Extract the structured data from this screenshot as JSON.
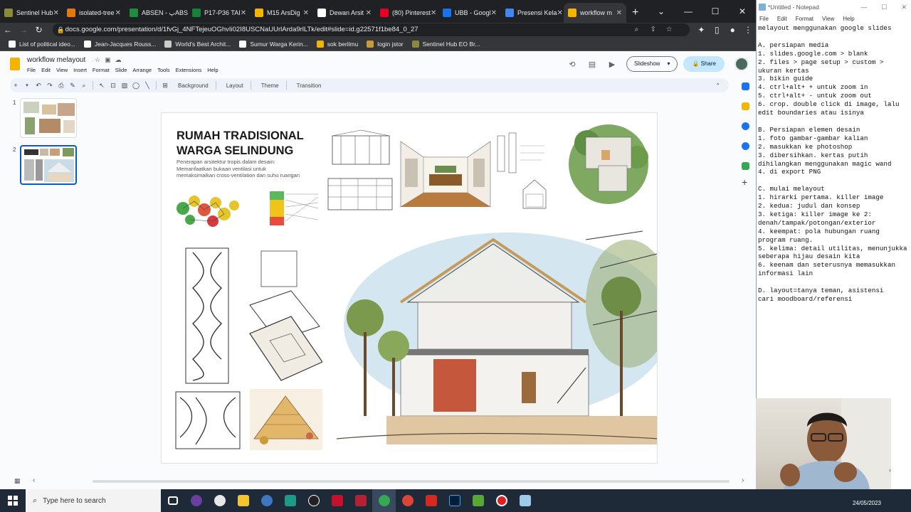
{
  "browser": {
    "tabs": [
      {
        "label": "Sentinel Hub",
        "color": "#8a8a3a"
      },
      {
        "label": "isolated-tree",
        "color": "#e07a10"
      },
      {
        "label": "ABSEN - پABSEN",
        "color": "#1e8e3e"
      },
      {
        "label": "P17-P36 TAI",
        "color": "#188038"
      },
      {
        "label": "M15 ArsDig",
        "color": "#f4b400"
      },
      {
        "label": "Dewan Arsit",
        "color": "#ffffff"
      },
      {
        "label": "(80) Pinterest",
        "color": "#e60023"
      },
      {
        "label": "UBB - Googl",
        "color": "#1a73e8"
      },
      {
        "label": "Presensi Kela",
        "color": "#4285f4"
      },
      {
        "label": "workflow m",
        "color": "#f4b400",
        "active": true
      }
    ],
    "url": "docs.google.com/presentation/d/1fvGj_4NFTejeuOGhvIi02I8USCNaUUrlArda9rlLTk/edit#slide=id.g22571f1be84_0_27",
    "bookmarks": [
      {
        "label": "List of political ideo...",
        "color": "#ffffff"
      },
      {
        "label": "Jean-Jacques Rouss...",
        "color": "#ffffff"
      },
      {
        "label": "World's Best Archit...",
        "color": "#cccccc"
      },
      {
        "label": "Sumur Warga Kerin...",
        "color": "#ffffff"
      },
      {
        "label": "sok berilmu",
        "color": "#f4b400"
      },
      {
        "label": "login jstor",
        "color": "#c89a3a"
      },
      {
        "label": "Sentinel Hub EO Br...",
        "color": "#8a8a3a"
      }
    ]
  },
  "slides": {
    "doc_title": "workflow melayout",
    "menus": [
      "File",
      "Edit",
      "View",
      "Insert",
      "Format",
      "Slide",
      "Arrange",
      "Tools",
      "Extensions",
      "Help"
    ],
    "slideshow_label": "Slideshow",
    "share_label": "Share",
    "toolbar_labels": [
      "Background",
      "Layout",
      "Theme",
      "Transition"
    ],
    "thumbs": [
      "1",
      "2"
    ],
    "slide": {
      "title": "RUMAH TRADISIONAL\nWARGA SELINDUNG",
      "subtitle": "Penerapan arsitektur tropis dalam desain:\nMemanfaatkan bukaan ventilasi untuk\nmemaksimalkan cross-ventilation dan suhu ruangan"
    }
  },
  "notepad": {
    "title": "*Untitled - Notepad",
    "menus": [
      "File",
      "Edit",
      "Format",
      "View",
      "Help"
    ],
    "text": "melayout menggunakan google slides\n\nA. persiapan media\n1. slides.google.com > blank\n2. files > page setup > custom >\nukuran kertas\n3. bikin guide\n4. ctrl+alt+ + untuk zoom in\n5. ctrl+alt+ - untuk zoom out\n6. crop. double click di image, lalu\nedit boundaries atau isinya\n\nB. Persiapan elemen desain\n1. foto gambar-gambar kalian\n2. masukkan ke photoshop\n3. dibersihkan. kertas putih\ndihilangkan menggunakan magic wand\n4. di export PNG\n\nC. mulai melayout\n1. hirarki pertama. killer image\n2. kedua: judul dan konsep\n3. ketiga: killer image ke 2:\ndenah/tampak/potongan/exterior\n4. keempat: pola hubungan ruang\nprogram ruang.\n5. kelima: detail utilitas, menunjukka\nseberapa hijau desain kita\n6. keenam dan seterusnya memasukkan\ninformasi lain\n\nD. layout=tanya teman, asistensi\ncari moodboard/referensi"
  },
  "taskbar": {
    "search_placeholder": "Type here to search",
    "date": "24/05/2023"
  }
}
